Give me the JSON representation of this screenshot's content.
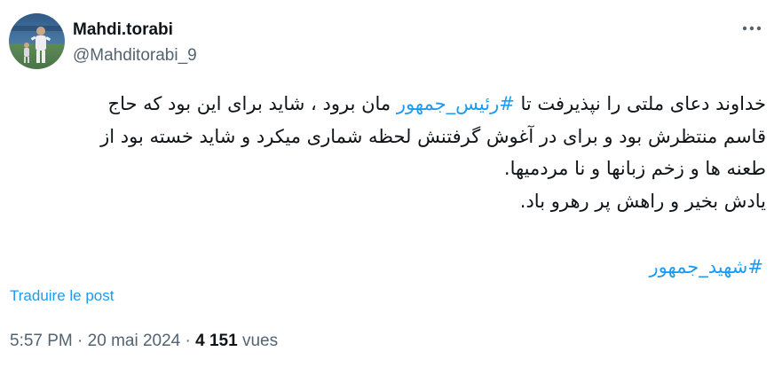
{
  "author": {
    "display_name": "Mahdi.torabi",
    "handle": "@Mahditorabi_9",
    "colors": {
      "sky": "#3f6d98",
      "field": "#5c8a56",
      "figure": "#e9e9ee"
    }
  },
  "menu": {
    "icon": "more-horizontal-icon"
  },
  "tweet": {
    "line1_before": "خداوند دعای ملتی را نپذیرفت تا ",
    "line1_hashtag": "#رئیس_جمهور",
    "line1_after": " مان برود ، شاید برای این بود که حاج",
    "line2": "قاسم منتظرش بود و برای در آغوش گرفتنش لحظه شماری میکرد و شاید خسته بود از",
    "line3": "طعنه ها و زخم زبانها و نا مردمیها.",
    "line4": "یادش بخیر و راهش پر رهرو باد.",
    "hashtag_footer": "#شهید_جمهور"
  },
  "translate_label": "Traduire le post",
  "meta": {
    "time": "5:57 PM",
    "separator": "·",
    "date": "20 mai 2024",
    "views_count": "4 151",
    "views_label": "vues"
  },
  "colors": {
    "text": "#0f1419",
    "secondary": "#536471",
    "accent": "#1d9bf0"
  }
}
